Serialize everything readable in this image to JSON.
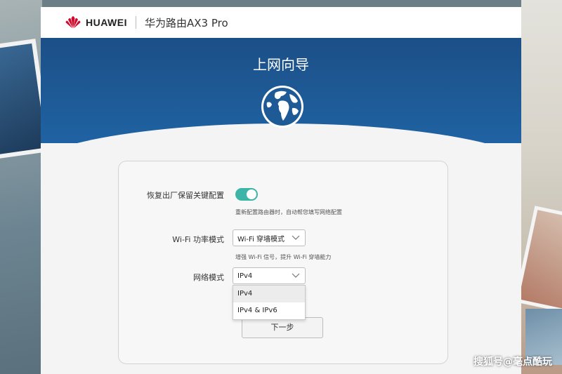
{
  "header": {
    "brand": "HUAWEI",
    "product": "华为路由AX3 Pro"
  },
  "hero": {
    "title": "上网向导"
  },
  "form": {
    "restore": {
      "label": "恢复出厂保留关键配置",
      "enabled": true,
      "hint": "重新配置路由器时，自动帮您填写网络配置"
    },
    "wifi_mode": {
      "label": "Wi-Fi 功率模式",
      "value": "Wi-Fi 穿墙模式",
      "hint": "增强 Wi-Fi 信号，提升 Wi-Fi 穿墙能力"
    },
    "network_mode": {
      "label": "网络模式",
      "value": "IPv4",
      "options": [
        "IPv4",
        "IPv4 & IPv6"
      ]
    },
    "next_label": "下一步"
  },
  "watermark": "搜狐号@毫点酷玩",
  "colors": {
    "hero_blue": "#1e5a96",
    "toggle_on": "#3cb5a8",
    "logo_red": "#cf0a2c"
  },
  "icons": [
    "huawei-logo",
    "globe-icon",
    "chevron-down-icon"
  ]
}
